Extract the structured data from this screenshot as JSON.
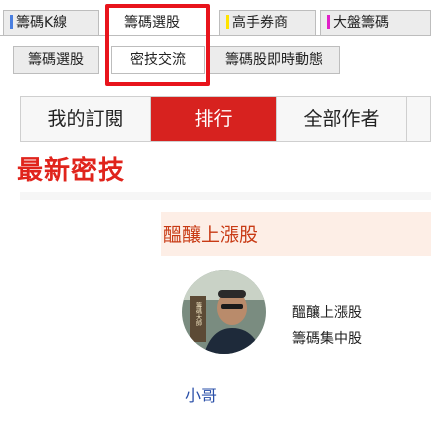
{
  "top_tabs": [
    {
      "label": "籌碼K線",
      "bar_color": "#4a7fe0"
    },
    {
      "label": "籌碼選股",
      "bar_color": ""
    },
    {
      "label": "高手券商",
      "bar_color": "#ffe300"
    },
    {
      "label": "大盤籌碼",
      "bar_color": "#e020c8"
    }
  ],
  "sub_tabs": [
    "籌碼選股",
    "密技交流",
    "籌碼股即時動態"
  ],
  "segments": [
    "我的訂閱",
    "排行",
    "全部作者"
  ],
  "section_title": "最新密技",
  "card": {
    "title": "醞釀上漲股",
    "lines": [
      "醞釀上漲股",
      "籌碼集中股"
    ],
    "author": "小哥",
    "avatar_badge": "籌碼大師"
  },
  "colors": {
    "accent_red": "#d7221f",
    "highlight_border": "#e8141c",
    "link_blue": "#2a4fa8"
  }
}
